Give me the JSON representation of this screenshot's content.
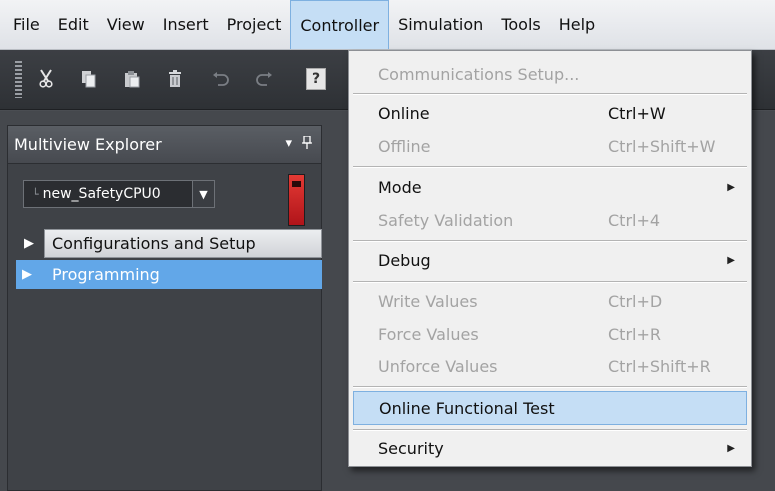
{
  "menubar": {
    "items": [
      "File",
      "Edit",
      "View",
      "Insert",
      "Project",
      "Controller",
      "Simulation",
      "Tools",
      "Help"
    ],
    "active": "Controller"
  },
  "toolbar": {
    "buttons": [
      "cut-icon",
      "copy-icon",
      "paste-icon",
      "delete-icon",
      "undo-icon",
      "redo-icon",
      "help-icon"
    ],
    "help_glyph": "?"
  },
  "explorer": {
    "title": "Multiview Explorer",
    "pin_glyph": "▾",
    "device_prefix": "└",
    "device_name": "new_SafetyCPU0",
    "cpu_indicator_color": "#d42a26",
    "tree": [
      {
        "label": "Configurations and Setup",
        "expanded": false
      },
      {
        "label": "Programming",
        "expanded": false,
        "selected": true
      }
    ],
    "selection_color": "#62a7e8"
  },
  "controller_menu": {
    "items": [
      {
        "label": "Communications Setup...",
        "shortcut": "",
        "enabled": false
      },
      {
        "label": "Online",
        "shortcut": "Ctrl+W",
        "enabled": true
      },
      {
        "label": "Offline",
        "shortcut": "Ctrl+Shift+W",
        "enabled": false
      },
      {
        "label": "Mode",
        "shortcut": "",
        "enabled": true,
        "submenu": true
      },
      {
        "label": "Safety Validation",
        "shortcut": "Ctrl+4",
        "enabled": false
      },
      {
        "label": "Debug",
        "shortcut": "",
        "enabled": true,
        "submenu": true
      },
      {
        "label": "Write Values",
        "shortcut": "Ctrl+D",
        "enabled": false
      },
      {
        "label": "Force Values",
        "shortcut": "Ctrl+R",
        "enabled": false
      },
      {
        "label": "Unforce Values",
        "shortcut": "Ctrl+Shift+R",
        "enabled": false
      },
      {
        "label": "Online Functional Test",
        "shortcut": "",
        "enabled": true,
        "highlighted": true
      },
      {
        "label": "Security",
        "shortcut": "",
        "enabled": true,
        "submenu": true
      }
    ],
    "highlight_color": "#c5def5"
  }
}
